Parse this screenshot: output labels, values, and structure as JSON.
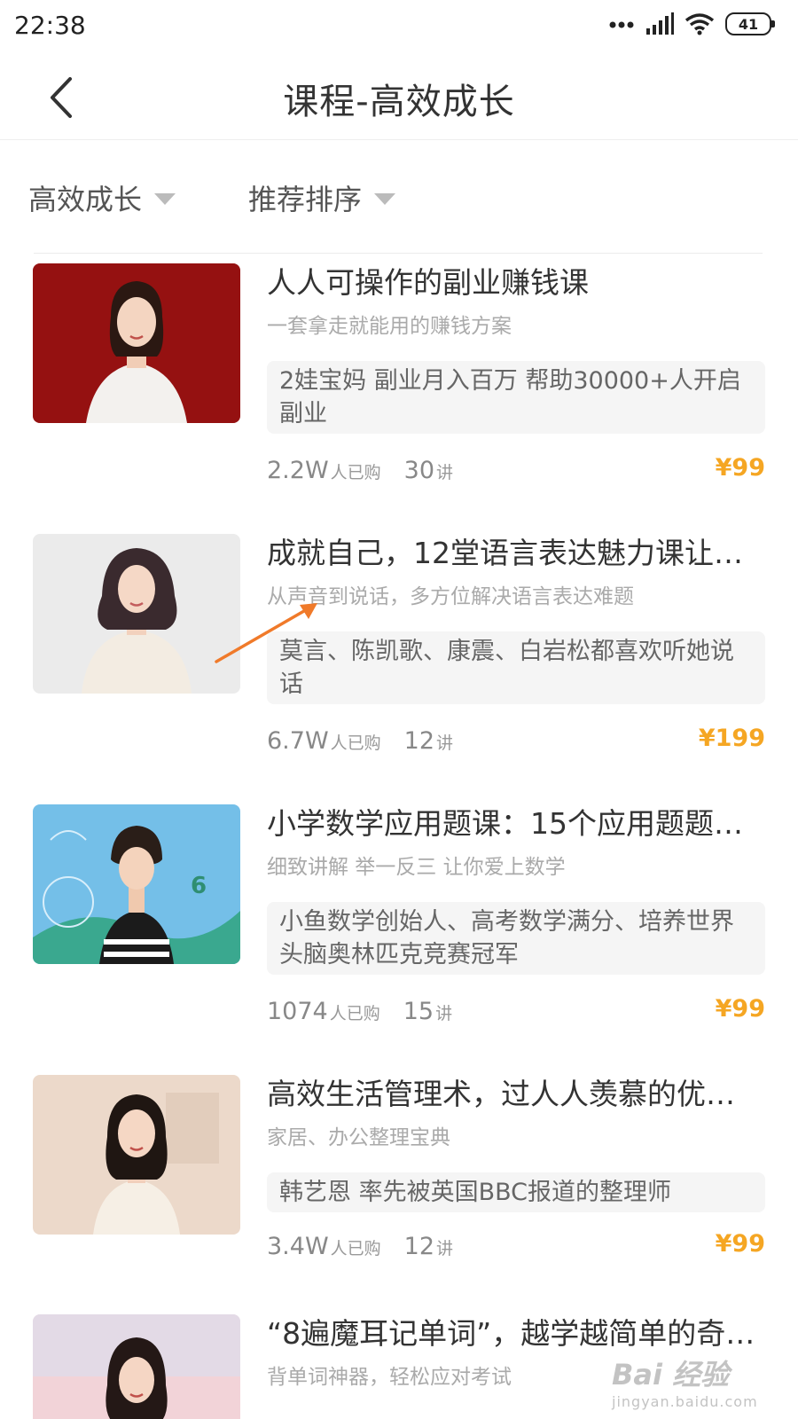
{
  "status": {
    "time": "22:38",
    "battery": "41"
  },
  "nav": {
    "title": "课程-高效成长"
  },
  "filters": [
    {
      "label": "高效成长"
    },
    {
      "label": "推荐排序"
    }
  ],
  "courses": [
    {
      "title": "人人可操作的副业赚钱课",
      "subtitle": "一套拿走就能用的赚钱方案",
      "desc": "2娃宝妈 副业月入百万 帮助30000+人开启副业",
      "buyers": "2.2W",
      "buyers_suffix": "人已购",
      "lessons": "30",
      "lessons_suffix": "讲",
      "price": "¥99"
    },
    {
      "title": "成就自己，12堂语言表达魅力课让…",
      "subtitle": "从声音到说话，多方位解决语言表达难题",
      "desc": "莫言、陈凯歌、康震、白岩松都喜欢听她说话",
      "buyers": "6.7W",
      "buyers_suffix": "人已购",
      "lessons": "12",
      "lessons_suffix": "讲",
      "price": "¥199"
    },
    {
      "title": "小学数学应用题课：15个应用题题…",
      "subtitle": "细致讲解 举一反三 让你爱上数学",
      "desc": "小鱼数学创始人、高考数学满分、培养世界头脑奥林匹克竞赛冠军",
      "buyers": "1074",
      "buyers_suffix": "人已购",
      "lessons": "15",
      "lessons_suffix": "讲",
      "price": "¥99"
    },
    {
      "title": "高效生活管理术，过人人羡慕的优…",
      "subtitle": "家居、办公整理宝典",
      "desc": "韩艺恩 率先被英国BBC报道的整理师",
      "buyers": "3.4W",
      "buyers_suffix": "人已购",
      "lessons": "12",
      "lessons_suffix": "讲",
      "price": "¥99"
    },
    {
      "title": "“8遍魔耳记单词”，越学越简单的奇…",
      "subtitle": "背单词神器，轻松应对考试"
    }
  ],
  "watermark": {
    "logo": "Bai 经验",
    "url": "jingyan.baidu.com"
  },
  "colors": {
    "price": "#f5a623",
    "title": "#333333",
    "muted": "#aaaaaa",
    "tag_bg": "#f5f5f5"
  }
}
